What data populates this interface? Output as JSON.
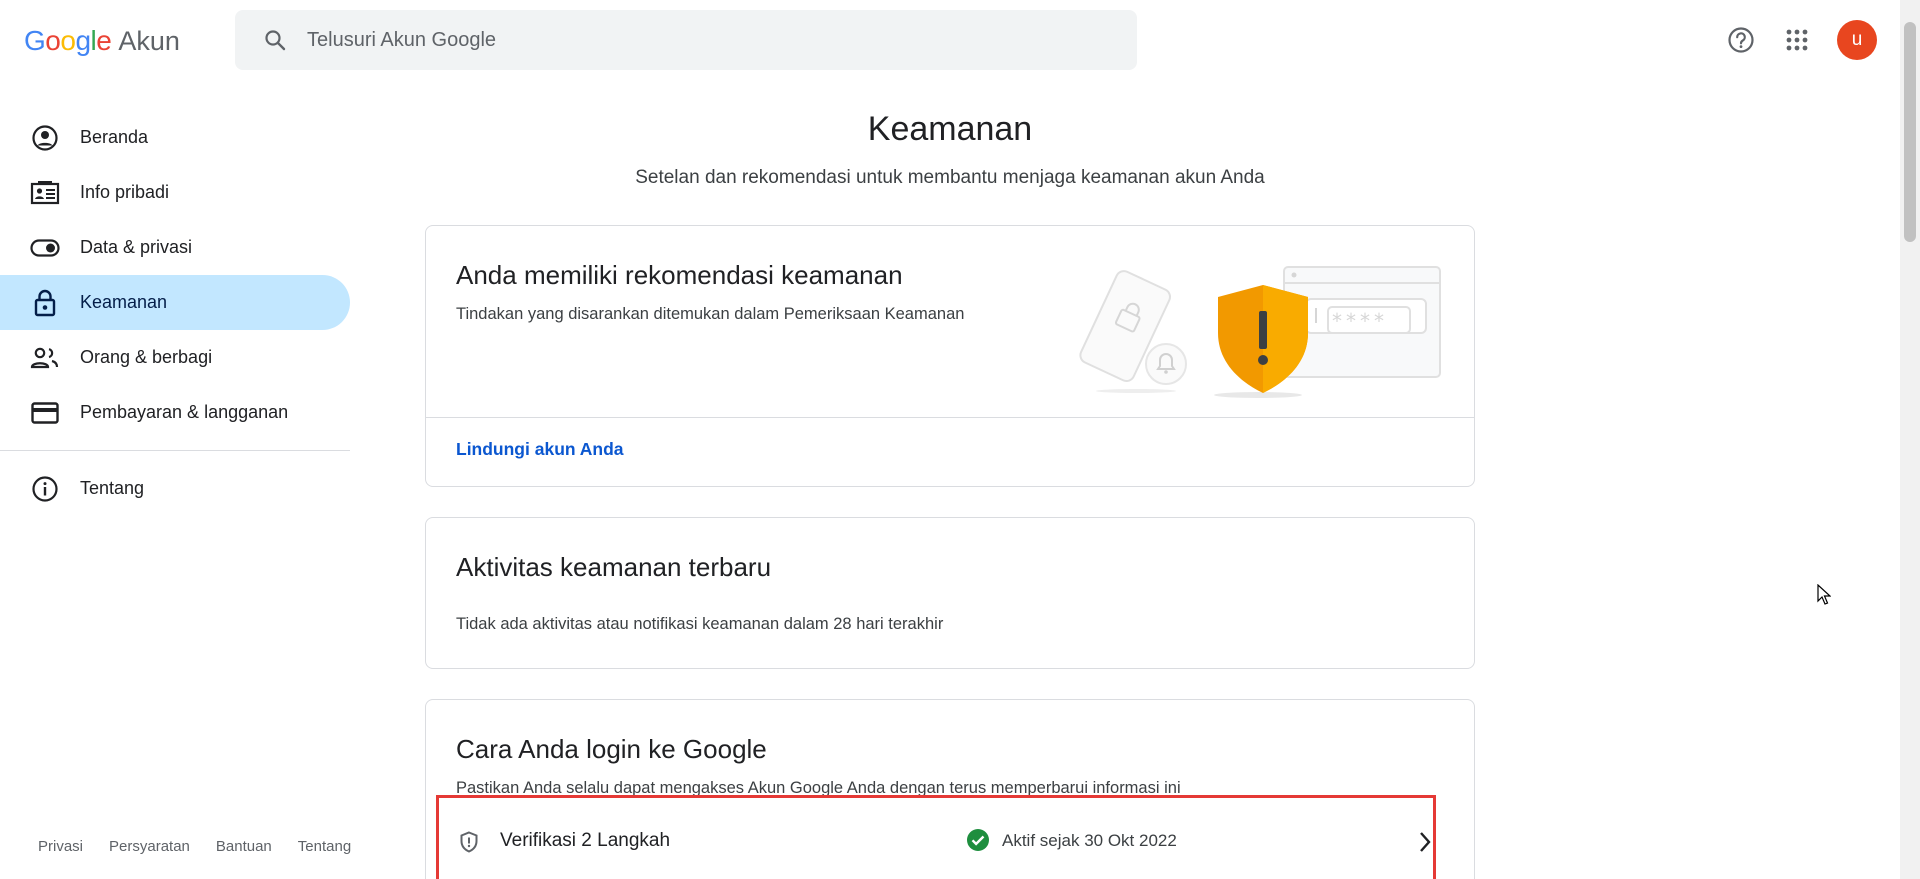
{
  "header": {
    "logo_google": [
      "G",
      "o",
      "o",
      "g",
      "l",
      "e"
    ],
    "logo_colors": [
      "#4285F4",
      "#EA4335",
      "#FBBC05",
      "#4285F4",
      "#34A853",
      "#EA4335"
    ],
    "logo_product": "Akun",
    "search_placeholder": "Telusuri Akun Google",
    "help_icon": "help-circle-icon",
    "apps_icon": "apps-grid-icon",
    "avatar_letter": "u",
    "avatar_color": "#e8461f"
  },
  "sidebar": {
    "items": [
      {
        "label": "Beranda",
        "icon": "account-circle-icon"
      },
      {
        "label": "Info pribadi",
        "icon": "id-card-icon"
      },
      {
        "label": "Data & privasi",
        "icon": "toggle-icon"
      },
      {
        "label": "Keamanan",
        "icon": "lock-icon",
        "active": true
      },
      {
        "label": "Orang & berbagi",
        "icon": "people-icon"
      },
      {
        "label": "Pembayaran & langganan",
        "icon": "credit-card-icon"
      }
    ],
    "about": {
      "label": "Tentang",
      "icon": "info-icon"
    },
    "footer": [
      "Privasi",
      "Persyaratan",
      "Bantuan",
      "Tentang"
    ]
  },
  "main": {
    "title": "Keamanan",
    "subtitle": "Setelan dan rekomendasi untuk membantu menjaga keamanan akun Anda",
    "recommendation_card": {
      "title": "Anda memiliki rekomendasi keamanan",
      "desc": "Tindakan yang disarankan ditemukan dalam Pemeriksaan Keamanan",
      "link": "Lindungi akun Anda",
      "password_mask": "****"
    },
    "activity_card": {
      "title": "Aktivitas keamanan terbaru",
      "desc": "Tidak ada aktivitas atau notifikasi keamanan dalam 28 hari terakhir"
    },
    "signin_card": {
      "title": "Cara Anda login ke Google",
      "desc": "Pastikan Anda selalu dapat mengakses Akun Google Anda dengan terus memperbarui informasi ini",
      "row": {
        "name": "Verifikasi 2 Langkah",
        "status": "Aktif sejak 30 Okt 2022",
        "status_color": "#1e8e3e",
        "highlight_color": "#e53935"
      }
    }
  }
}
